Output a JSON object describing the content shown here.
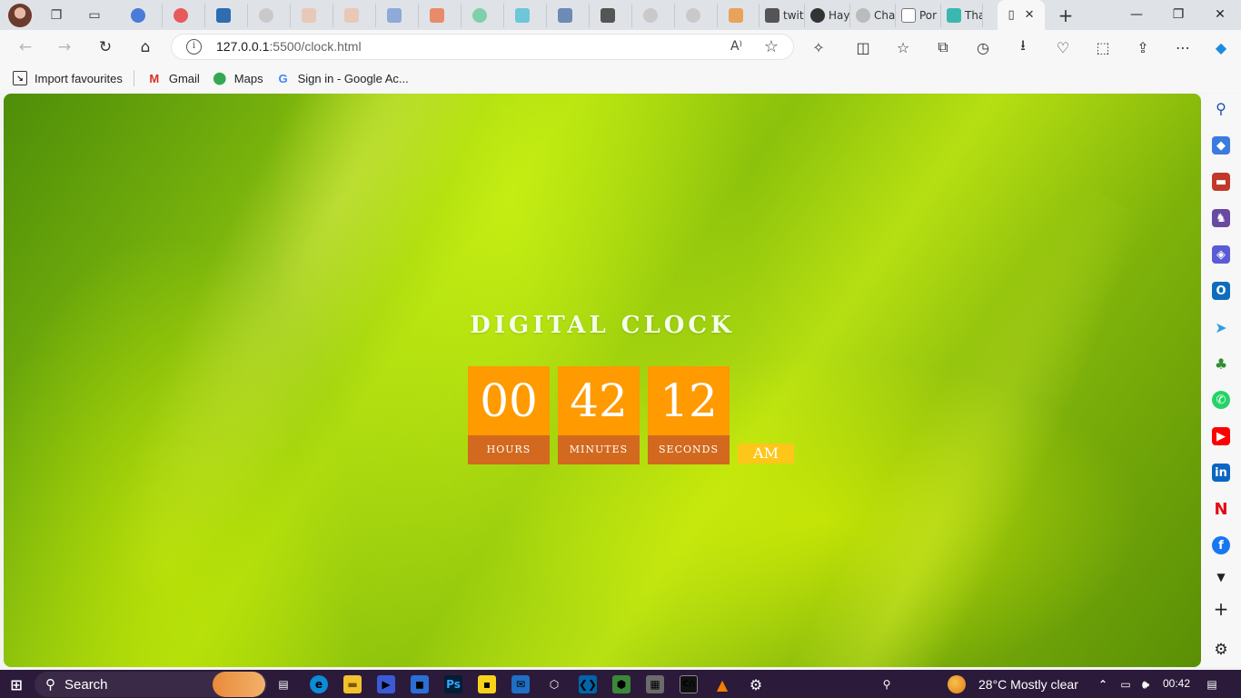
{
  "browser": {
    "tabs": [
      {
        "label": ""
      },
      {
        "label": ""
      },
      {
        "label": ""
      },
      {
        "label": ""
      },
      {
        "label": ""
      },
      {
        "label": ""
      },
      {
        "label": ""
      },
      {
        "label": ""
      },
      {
        "label": ""
      },
      {
        "label": ""
      },
      {
        "label": ""
      },
      {
        "label": ""
      },
      {
        "label": ""
      },
      {
        "label": ""
      },
      {
        "label": "twit"
      },
      {
        "label": "Hay"
      },
      {
        "label": "Cha"
      },
      {
        "label": "Por"
      },
      {
        "label": "Tha"
      }
    ],
    "active_tab_close": "✕",
    "url_host": "127.0.0.1",
    "url_path": ":5500/clock.html",
    "read_aloud": "A⁾"
  },
  "bookmarks": [
    {
      "label": "Import favourites",
      "icon": "import-icon"
    },
    {
      "label": "Gmail",
      "icon": "gmail-icon"
    },
    {
      "label": "Maps",
      "icon": "maps-icon"
    },
    {
      "label": "Sign in - Google Ac...",
      "icon": "google-icon"
    }
  ],
  "clock": {
    "title": "DIGITAL CLOCK",
    "hours": "00",
    "minutes": "42",
    "seconds": "12",
    "hours_label": "HOURS",
    "minutes_label": "MINUTES",
    "seconds_label": "SECONDS",
    "ampm": "AM"
  },
  "colors": {
    "digit_bg": "#ff9a00",
    "label_bg": "#d2691e",
    "ampm_bg": "#ffc61a",
    "background": "#8cc20c"
  },
  "taskbar": {
    "search_label": "Search",
    "weather": "28°C",
    "weather_desc": "Mostly clear",
    "time": "00:42"
  }
}
